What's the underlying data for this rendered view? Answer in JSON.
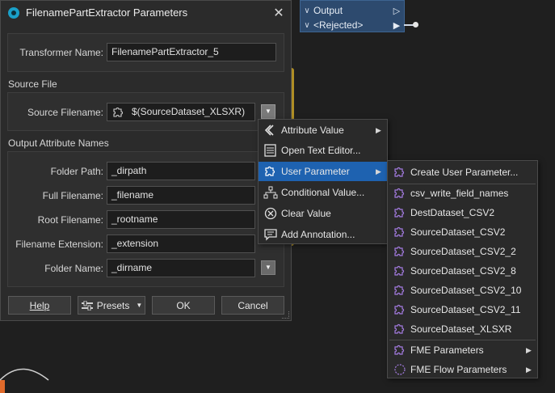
{
  "canvas": {
    "node_ports": [
      {
        "label": "Output"
      },
      {
        "label": "<Rejected>"
      }
    ]
  },
  "dialog": {
    "title": "FilenamePartExtractor Parameters",
    "transformer_name": {
      "label": "Transformer Name:",
      "value": "FilenamePartExtractor_5"
    },
    "source_file": {
      "section": "Source File",
      "label": "Source Filename:",
      "value": "$(SourceDataset_XLSXR)"
    },
    "output_attributes": {
      "section": "Output Attribute Names",
      "rows": [
        {
          "label": "Folder Path:",
          "value": "_dirpath"
        },
        {
          "label": "Full Filename:",
          "value": "_filename"
        },
        {
          "label": "Root Filename:",
          "value": "_rootname"
        },
        {
          "label": "Filename Extension:",
          "value": "_extension"
        },
        {
          "label": "Folder Name:",
          "value": "_dirname"
        }
      ]
    },
    "buttons": {
      "help": "Help",
      "presets": "Presets",
      "ok": "OK",
      "cancel": "Cancel"
    }
  },
  "context_menu": {
    "items": [
      {
        "label": "Attribute Value",
        "icon": "attribute-value-icon",
        "submenu": true
      },
      {
        "label": "Open Text Editor...",
        "icon": "text-editor-icon",
        "submenu": false
      },
      {
        "label": "User Parameter",
        "icon": "user-parameter-icon",
        "submenu": true,
        "highlighted": true
      },
      {
        "label": "Conditional Value...",
        "icon": "conditional-value-icon",
        "submenu": false
      },
      {
        "label": "Clear Value",
        "icon": "clear-value-icon",
        "submenu": false
      },
      {
        "label": "Add Annotation...",
        "icon": "annotation-icon",
        "submenu": false
      }
    ]
  },
  "user_parameter_menu": {
    "create": "Create User Parameter...",
    "parameters": [
      "csv_write_field_names",
      "DestDataset_CSV2",
      "SourceDataset_CSV2",
      "SourceDataset_CSV2_2",
      "SourceDataset_CSV2_8",
      "SourceDataset_CSV2_10",
      "SourceDataset_CSV2_11",
      "SourceDataset_XLSXR"
    ],
    "groups": [
      "FME Parameters",
      "FME Flow Parameters"
    ]
  },
  "colors": {
    "highlight": "#1e62b0",
    "puzzle": "#a37be0",
    "node": "#2d4a6e"
  }
}
